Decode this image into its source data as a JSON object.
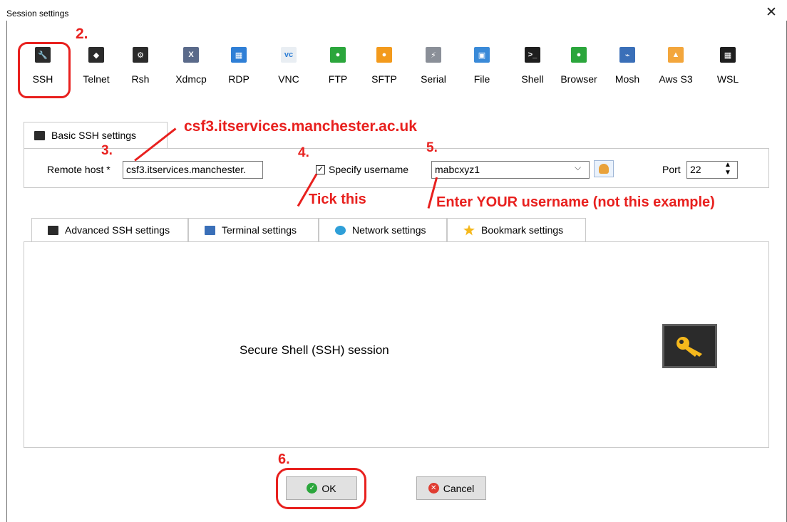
{
  "window": {
    "title": "Session settings",
    "close_glyph": "✕"
  },
  "session_types": [
    {
      "label": "SSH",
      "icon": "key-icon",
      "color": "#2b2b2b",
      "glyph": "🔧"
    },
    {
      "label": "Telnet",
      "icon": "telnet-icon",
      "color": "#2b2b2b",
      "glyph": "◆"
    },
    {
      "label": "Rsh",
      "icon": "rsh-icon",
      "color": "#2b2b2b",
      "glyph": "⚙"
    },
    {
      "label": "Xdmcp",
      "icon": "xdmcp-icon",
      "color": "#5a6a8a",
      "glyph": "X"
    },
    {
      "label": "RDP",
      "icon": "rdp-icon",
      "color": "#2f7fd6",
      "glyph": "▦"
    },
    {
      "label": "VNC",
      "icon": "vnc-icon",
      "color": "#e9eef3",
      "glyph": "vc"
    },
    {
      "label": "FTP",
      "icon": "ftp-icon",
      "color": "#2ba63c",
      "glyph": "●"
    },
    {
      "label": "SFTP",
      "icon": "sftp-icon",
      "color": "#f39a1c",
      "glyph": "●"
    },
    {
      "label": "Serial",
      "icon": "serial-icon",
      "color": "#8a8f98",
      "glyph": "⚡"
    },
    {
      "label": "File",
      "icon": "file-icon",
      "color": "#3a8ad8",
      "glyph": "▣"
    },
    {
      "label": "Shell",
      "icon": "shell-icon",
      "color": "#1e1e1e",
      "glyph": ">_"
    },
    {
      "label": "Browser",
      "icon": "browser-icon",
      "color": "#2ba63c",
      "glyph": "●"
    },
    {
      "label": "Mosh",
      "icon": "mosh-icon",
      "color": "#3a6fb8",
      "glyph": "⌁"
    },
    {
      "label": "Aws S3",
      "icon": "aws-s3-icon",
      "color": "#f3a63c",
      "glyph": "▲"
    },
    {
      "label": "WSL",
      "icon": "wsl-icon",
      "color": "#1e1e1e",
      "glyph": "▦"
    }
  ],
  "basic_tab": {
    "label": "Basic SSH settings"
  },
  "remote_host": {
    "label": "Remote host *",
    "value": "csf3.itservices.manchester."
  },
  "specify_username": {
    "label": "Specify username",
    "checked": true,
    "check_glyph": "✓"
  },
  "username": {
    "value": "mabcxyz1"
  },
  "port": {
    "label": "Port",
    "value": "22"
  },
  "lower_tabs": [
    {
      "label": "Advanced SSH settings",
      "icon": "key-icon"
    },
    {
      "label": "Terminal settings",
      "icon": "terminal-icon"
    },
    {
      "label": "Network settings",
      "icon": "network-icon"
    },
    {
      "label": "Bookmark settings",
      "icon": "star-icon"
    }
  ],
  "panel": {
    "description": "Secure Shell (SSH) session"
  },
  "buttons": {
    "ok": "OK",
    "cancel": "Cancel"
  },
  "annotations": {
    "step2": "2.",
    "step3": "3.",
    "step4": "4.",
    "step5": "5.",
    "step6": "6.",
    "host_callout": "csf3.itservices.manchester.ac.uk",
    "tick_callout": "Tick this",
    "username_callout": "Enter YOUR username (not this example)"
  },
  "colors": {
    "annotation": "#e8201e",
    "ok_icon": "#2ba63c",
    "cancel_icon": "#e03c31"
  }
}
